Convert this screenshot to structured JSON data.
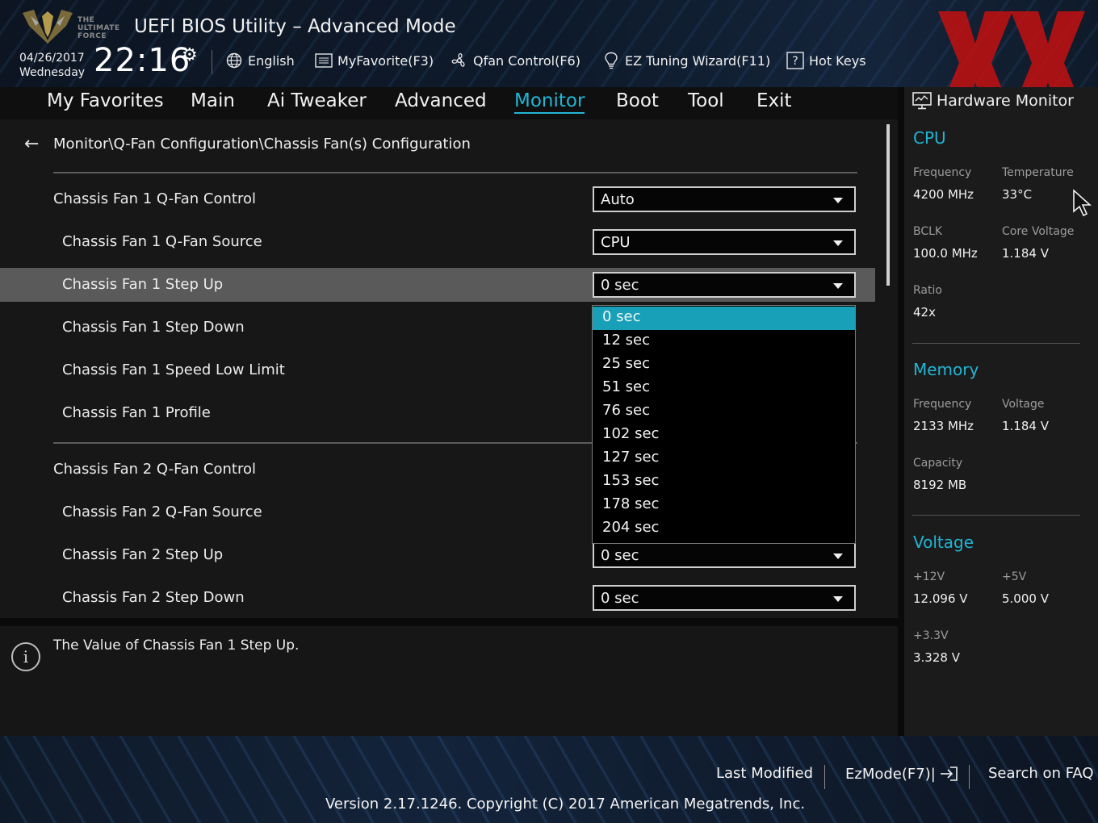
{
  "header": {
    "app_title": "UEFI BIOS Utility – Advanced Mode",
    "logo_text": [
      "THE",
      "ULTIMATE",
      "FORCE"
    ],
    "date": "04/26/2017",
    "weekday": "Wednesday",
    "time": "22:16",
    "tools": [
      {
        "label": "English",
        "icon": "globe-icon"
      },
      {
        "label": "MyFavorite(F3)",
        "icon": "favorite-list-icon"
      },
      {
        "label": "Qfan Control(F6)",
        "icon": "fan-icon"
      },
      {
        "label": "EZ Tuning Wizard(F11)",
        "icon": "lightbulb-icon"
      },
      {
        "label": "Hot Keys",
        "icon": "help-key-icon"
      }
    ],
    "accent_color": "#22b5d4"
  },
  "nav": {
    "tabs": [
      "My Favorites",
      "Main",
      "Ai Tweaker",
      "Advanced",
      "Monitor",
      "Boot",
      "Tool",
      "Exit"
    ],
    "active": "Monitor"
  },
  "main": {
    "breadcrumb": "Monitor\\Q-Fan Configuration\\Chassis Fan(s) Configuration",
    "rows": [
      {
        "label": "Chassis Fan 1 Q-Fan Control",
        "value": "Auto"
      },
      {
        "label": "Chassis Fan 1 Q-Fan Source",
        "value": "CPU"
      },
      {
        "label": "Chassis Fan 1 Step Up",
        "value": "0 sec"
      },
      {
        "label": "Chassis Fan 1 Step Down",
        "value": ""
      },
      {
        "label": "Chassis Fan 1 Speed Low Limit",
        "value": ""
      },
      {
        "label": "Chassis Fan 1 Profile",
        "value": ""
      },
      {
        "label": "Chassis Fan 2 Q-Fan Control",
        "value": ""
      },
      {
        "label": "Chassis Fan 2 Q-Fan Source",
        "value": ""
      },
      {
        "label": "Chassis Fan 2 Step Up",
        "value": "0 sec"
      },
      {
        "label": "Chassis Fan 2 Step Down",
        "value": "0 sec"
      }
    ],
    "open_dropdown_options": [
      "0 sec",
      "12 sec",
      "25 sec",
      "51 sec",
      "76 sec",
      "102 sec",
      "127 sec",
      "153 sec",
      "178 sec",
      "204 sec"
    ],
    "selected_option": "0 sec",
    "help_text": "The Value of Chassis Fan 1 Step Up."
  },
  "hw": {
    "title": "Hardware Monitor",
    "cpu": {
      "title": "CPU",
      "frequency_label": "Frequency",
      "frequency": "4200 MHz",
      "temperature_label": "Temperature",
      "temperature": "33°C",
      "bclk_label": "BCLK",
      "bclk": "100.0 MHz",
      "core_voltage_label": "Core Voltage",
      "core_voltage": "1.184 V",
      "ratio_label": "Ratio",
      "ratio": "42x"
    },
    "memory": {
      "title": "Memory",
      "frequency_label": "Frequency",
      "frequency": "2133 MHz",
      "voltage_label": "Voltage",
      "voltage": "1.184 V",
      "capacity_label": "Capacity",
      "capacity": "8192 MB"
    },
    "voltage": {
      "title": "Voltage",
      "v12_label": "+12V",
      "v12": "12.096 V",
      "v5_label": "+5V",
      "v5": "5.000 V",
      "v33_label": "+3.3V",
      "v33": "3.328 V"
    }
  },
  "footer": {
    "last_modified": "Last Modified",
    "ezmode": "EzMode(F7)|",
    "search_faq": "Search on FAQ",
    "version": "Version 2.17.1246. Copyright (C) 2017 American Megatrends, Inc."
  }
}
